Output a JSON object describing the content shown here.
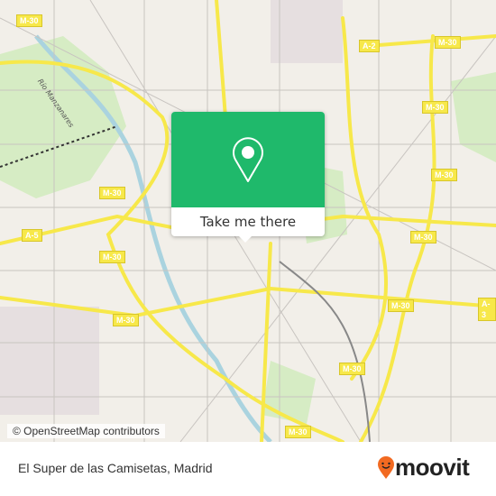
{
  "map": {
    "attribution": "© OpenStreetMap contributors",
    "river_label": "Río Manzanares",
    "road_shields": [
      "M-30",
      "A-2",
      "M-30",
      "M-30",
      "M-30",
      "M-30",
      "A-5",
      "M-30",
      "M-30",
      "M-30",
      "A-3",
      "M-30",
      "M-30",
      "M-30"
    ],
    "colors": {
      "background": "#f2efe9",
      "major_road": "#f7e84a",
      "park": "#d6ecc4",
      "accent": "#1fb96b"
    }
  },
  "popup": {
    "icon": "location-pin-icon",
    "button_label": "Take me there"
  },
  "footer": {
    "place_title": "El Super de las Camisetas, Madrid",
    "brand": "moovit",
    "brand_color": "#f26a21"
  }
}
